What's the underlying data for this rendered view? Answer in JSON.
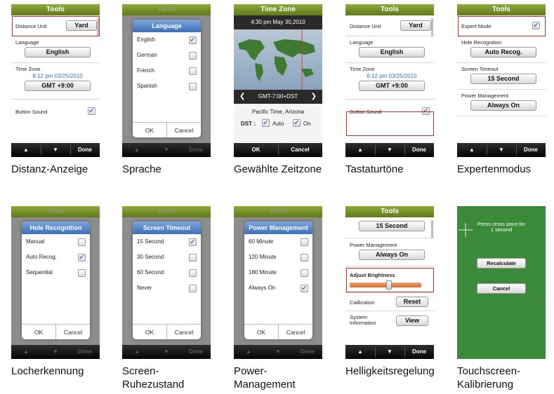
{
  "common": {
    "title": "Tools",
    "done": "Done",
    "ok": "OK",
    "cancel": "Cancel"
  },
  "screens": {
    "distance": {
      "caption": "Distanz-Anzeige",
      "distance_label": "Distance Unit",
      "distance_value": "Yard",
      "language_label": "Language",
      "language_value": "English",
      "timezone_label": "Time Zone",
      "timezone_time": "6:12 pm 03/25/2010",
      "timezone_value": "GMT +9:00",
      "button_sound_label": "Button Sound",
      "button_sound_checked": true
    },
    "language": {
      "caption": "Sprache",
      "dialog_title": "Language",
      "options": [
        {
          "label": "English",
          "checked": true
        },
        {
          "label": "German",
          "checked": false
        },
        {
          "label": "French",
          "checked": false
        },
        {
          "label": "Spanish",
          "checked": false
        }
      ]
    },
    "timezone": {
      "caption": "Gewählte Zeitzone",
      "title": "Time Zone",
      "datetime": "4:30 pm May 30,2010",
      "zone": "GMT-7:00+DST",
      "place": "Pacific Time, Arizona",
      "dst_label": "DST :",
      "auto_label": "Auto",
      "on_label": "On",
      "ok": "OK",
      "cancel": "Cancel"
    },
    "sound": {
      "caption": "Tastaturtöne"
    },
    "expert": {
      "caption": "Expertenmodus",
      "expert_label": "Expert Mode",
      "hole_label": "Hole Recognition",
      "hole_value": "Auto Recog.",
      "timeout_label": "Screen Timeout",
      "timeout_value": "15 Second",
      "power_label": "Power Management",
      "power_value": "Always On"
    },
    "hole": {
      "caption": "Locherkennung",
      "dialog_title": "Hole Recognition",
      "options": [
        {
          "label": "Manual",
          "checked": false
        },
        {
          "label": "Auto Recog.",
          "checked": true
        },
        {
          "label": "Sequential",
          "checked": false
        }
      ]
    },
    "screen_timeout": {
      "caption_line1": "Screen-",
      "caption_line2": "Ruhezustand",
      "dialog_title": "Screen Timeout",
      "options": [
        {
          "label": "15 Second",
          "checked": true
        },
        {
          "label": "30 Second",
          "checked": false
        },
        {
          "label": "60 Second",
          "checked": false
        },
        {
          "label": "Never",
          "checked": false
        }
      ]
    },
    "power": {
      "caption_line1": "Power-",
      "caption_line2": "Management",
      "dialog_title": "Power Management",
      "options": [
        {
          "label": "60 Minute",
          "checked": false
        },
        {
          "label": "120 Minute",
          "checked": false
        },
        {
          "label": "180 Minute",
          "checked": false
        },
        {
          "label": "Always On",
          "checked": true
        }
      ]
    },
    "brightness": {
      "caption": "Helligkeitsregelung",
      "timeout_value": "15 Second",
      "power_label": "Power Management",
      "power_value": "Always On",
      "brightness_label": "Adjust Brightness",
      "brightness_level": 0.55,
      "calibration_label": "Calibration",
      "calibration_button": "Reset",
      "sysinfo_label_line1": "System",
      "sysinfo_label_line2": "Information",
      "sysinfo_button": "View"
    },
    "calibration": {
      "caption_line1": "Touchscreen-",
      "caption_line2": "Kalibrierung",
      "instruction_line1": "Press cross point for",
      "instruction_line2": "1 second",
      "recalculate": "Recalculate",
      "cancel": "Cancel"
    }
  },
  "colors": {
    "title_green": "#6f8b24",
    "dialog_blue": "#4a7bc0",
    "highlight_red": "#d62828",
    "calibration_green": "#3a8a3a",
    "link_blue": "#2f6fc4",
    "slider_orange": "#e0793a"
  }
}
